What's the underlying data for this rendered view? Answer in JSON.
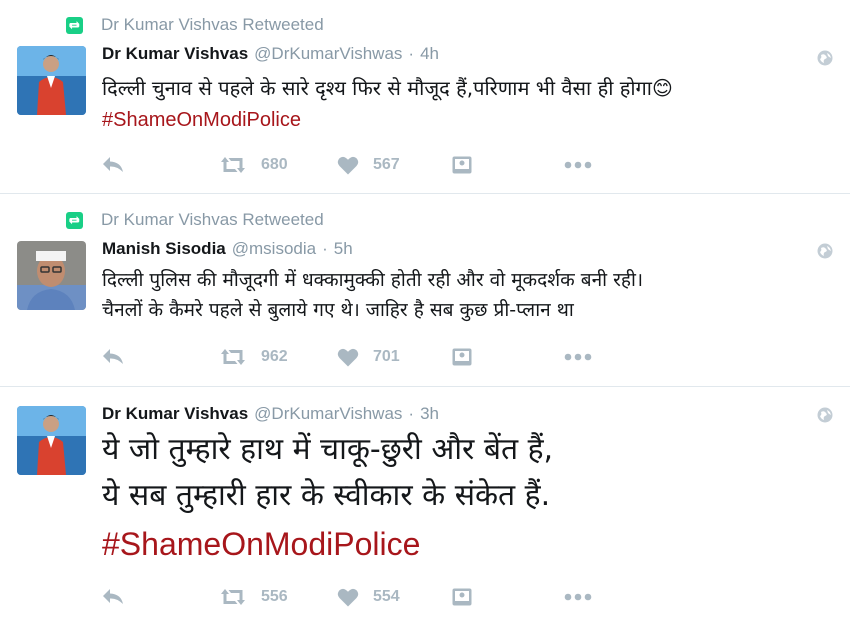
{
  "tweets": [
    {
      "retweeted_by": "Dr Kumar Vishvas Retweeted",
      "author_name": "Dr Kumar Vishvas",
      "handle": "@DrKumarVishwas",
      "separator": "·",
      "time": "4h",
      "lines": [
        "दिल्ली चुनाव से पहले के सारे दृश्य फिर से मौजूद हैं,परिणाम भी वैसा ही होगा😊"
      ],
      "hashtag": "#ShameOnModiPolice",
      "retweets": "680",
      "likes": "567",
      "avatar": "avatar-kumar-vishvas"
    },
    {
      "retweeted_by": "Dr Kumar Vishvas Retweeted",
      "author_name": "Manish Sisodia",
      "handle": "@msisodia",
      "separator": "·",
      "time": "5h",
      "lines": [
        "दिल्ली पुलिस की मौजूदगी में धक्कामुक्की होती रही और वो मूकदर्शक बनी रही।",
        "चैनलों के कैमरे पहले से बुलाये गए थे। जाहिर है सब कुछ प्री-प्लान था"
      ],
      "retweets": "962",
      "likes": "701",
      "avatar": "avatar-manish-sisodia"
    },
    {
      "author_name": "Dr Kumar Vishvas",
      "handle": "@DrKumarVishwas",
      "separator": "·",
      "time": "3h",
      "lines": [
        "ये जो तुम्हारे हाथ में चाकू-छुरी और बेंत हैं,",
        "ये सब तुम्हारी हार के स्वीकार के संकेत हैं."
      ],
      "hashtag": "#ShameOnModiPolice",
      "retweets": "556",
      "likes": "554",
      "avatar": "avatar-kumar-vishvas"
    }
  ],
  "icons": {
    "retweet_context": "retweet-icon",
    "reply": "reply-icon",
    "retweet": "retweet-icon",
    "like": "heart-icon",
    "media": "media-icon",
    "more": "more-icon",
    "globe": "globe-icon"
  },
  "colors": {
    "hashtag": "#a7161b",
    "muted": "#8899a6",
    "action": "#aab8c2",
    "retweet_badge": "#19cf86"
  }
}
